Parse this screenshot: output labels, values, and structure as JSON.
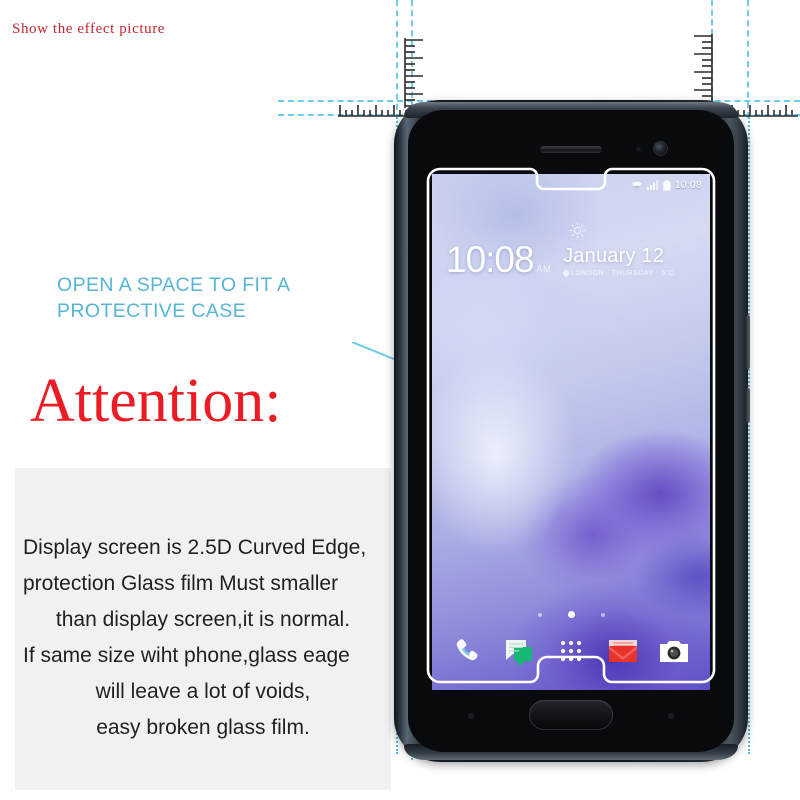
{
  "page": {
    "top_label": "Show the effect picture",
    "background_color": "#ffffff"
  },
  "colors": {
    "label_red": "#c1272d",
    "attention_red": "#ec1c24",
    "callout_blue": "#56b5d4",
    "guide_cyan": "#6fc9e8",
    "panel_gray": "#f1f0f3"
  },
  "callout": {
    "line1": "OPEN A SPACE TO FIT A",
    "line2": "PROTECTIVE CASE"
  },
  "attention": {
    "heading": "Attention:"
  },
  "warning": {
    "lines": [
      "Display screen is 2.5D Curved Edge,",
      "protection Glass film Must smaller",
      "than display screen,it is normal.",
      "If same size wiht phone,glass eage",
      "will leave a lot of voids,",
      "easy broken glass film."
    ]
  },
  "phone": {
    "status_bar": {
      "wifi_icon": "wifi-icon",
      "signal_icon": "signal-bars-icon",
      "battery_icon": "battery-icon",
      "time": "10:08"
    },
    "lockscreen": {
      "clock": "10:08",
      "meridiem": "AM",
      "weather_icon": "sun-icon",
      "date": "January 12",
      "location_icon": "location-pin-icon",
      "subline": "LONDON  ·  THURSDAY  ·  5°C"
    },
    "page_indicator": {
      "count": 3,
      "active_index": 1
    },
    "dock": [
      {
        "name": "phone-dialer",
        "icon": "phone-handset-icon"
      },
      {
        "name": "messages",
        "icon": "message-bubble-icon"
      },
      {
        "name": "app-drawer",
        "icon": "grid-dots-icon"
      },
      {
        "name": "gmail",
        "icon": "envelope-icon"
      },
      {
        "name": "camera",
        "icon": "camera-icon"
      }
    ],
    "hardware": {
      "earpiece": "earpiece-speaker",
      "front_camera": "front-camera-lens",
      "proximity_sensor": "proximity-sensor",
      "home_button": "home-button",
      "volume_buttons": "volume-rocker"
    },
    "film_overlay": "tempered-glass-film-outline"
  },
  "measurement": {
    "ruler_top_left": "ruler-vertical-left",
    "ruler_top_right": "ruler-vertical-right",
    "ruler_horizontal_left": "ruler-horizontal-left",
    "ruler_horizontal_right": "ruler-horizontal-right",
    "guides": "alignment-guide-lines"
  }
}
